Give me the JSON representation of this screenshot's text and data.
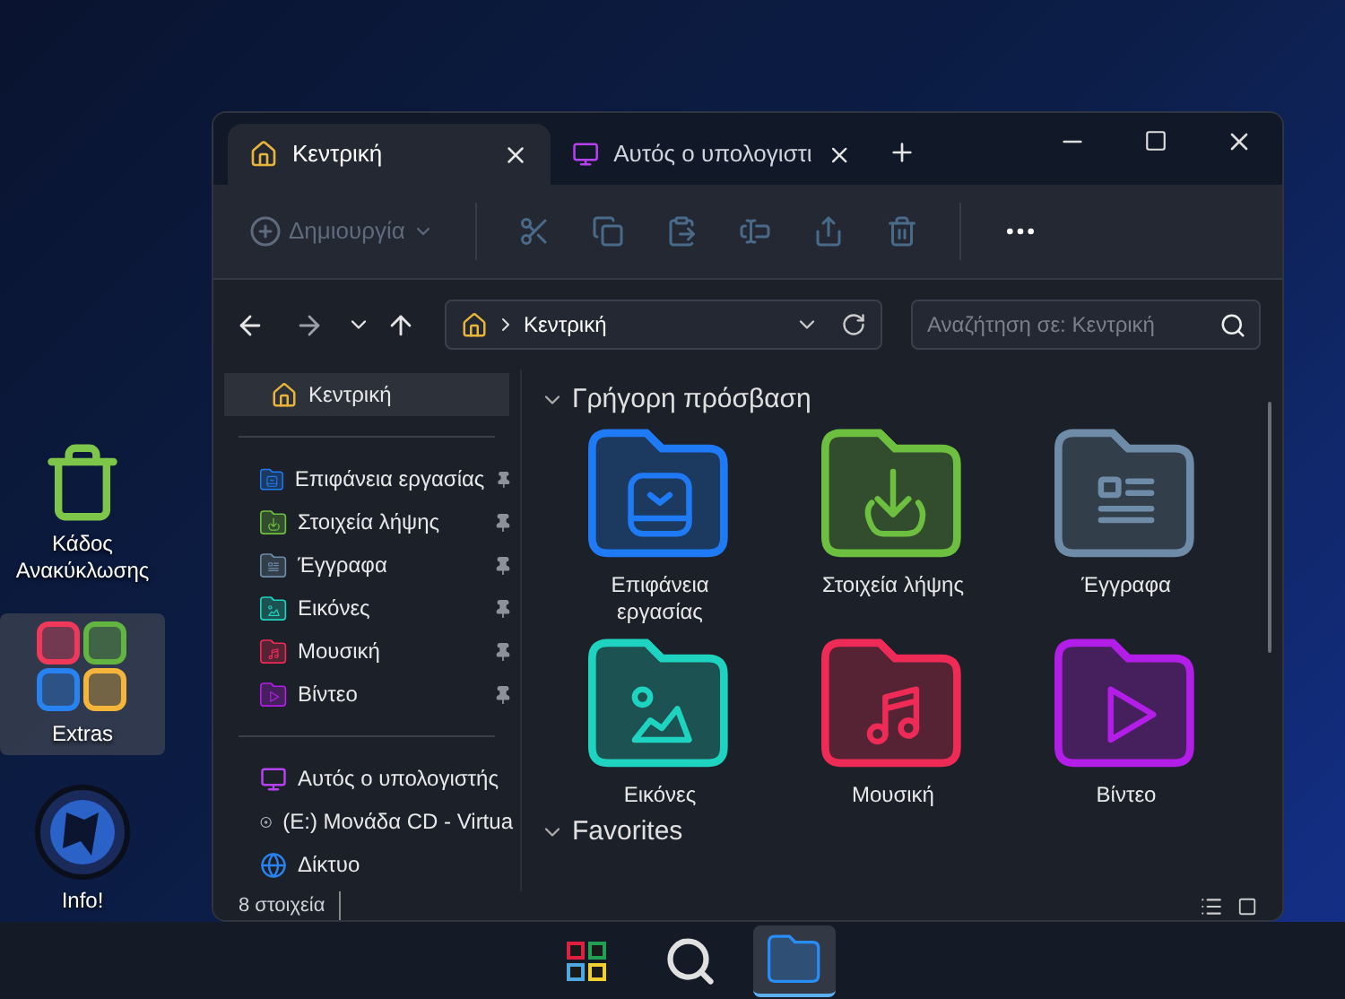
{
  "desktop_icons": [
    {
      "kind": "recycle",
      "label": "Κάδος Ανακύκλωσης",
      "selected": false
    },
    {
      "kind": "extras",
      "label": "Extras",
      "selected": true
    },
    {
      "kind": "info",
      "label": "Info!",
      "selected": false
    }
  ],
  "window": {
    "tabs": [
      {
        "kind": "home",
        "label": "Κεντρική",
        "selected": true
      },
      {
        "kind": "pc",
        "label": "Αυτός ο υπολογιστι",
        "selected": false
      }
    ],
    "toolbar": {
      "new_label": "Δημιουργία"
    },
    "address": "Κεντρική",
    "search": {
      "placeholder": "Αναζήτηση σε: Κεντρική"
    },
    "sidebar": [
      {
        "items": [
          {
            "kind": "home",
            "label": "Κεντρική",
            "selected": true
          }
        ]
      },
      {
        "items": [
          {
            "kind": "desktop",
            "color": "#1e7bf5",
            "label": "Επιφάνεια εργασίας",
            "selected": false,
            "pinned": true
          },
          {
            "kind": "download",
            "color": "#6cbf3f",
            "label": "Στοιχεία λήψης",
            "selected": false,
            "pinned": true
          },
          {
            "kind": "document",
            "color": "#6e8ca8",
            "label": "Έγγραφα",
            "selected": false,
            "pinned": true
          },
          {
            "kind": "picture",
            "color": "#1ed3c0",
            "label": "Εικόνες",
            "selected": false,
            "pinned": true
          },
          {
            "kind": "music",
            "color": "#ee2a56",
            "label": "Μουσική",
            "selected": false,
            "pinned": true
          },
          {
            "kind": "video",
            "color": "#b21ee8",
            "label": "Βίντεο",
            "selected": false,
            "pinned": true
          }
        ]
      },
      {
        "items": [
          {
            "kind": "pc",
            "label": "Αυτός ο υπολογιστής",
            "selected": false
          },
          {
            "kind": "cd",
            "label": "(E:) Μονάδα CD - Virtua",
            "selected": false
          },
          {
            "kind": "network",
            "label": "Δίκτυο",
            "selected": false
          }
        ]
      }
    ],
    "sections": [
      {
        "title": "Γρήγορη πρόσβαση",
        "expanded": true,
        "items": [
          {
            "kind": "desktop",
            "color": "#1e7bf5",
            "label": "Επιφάνεια εργασίας"
          },
          {
            "kind": "download",
            "color": "#6cbf3f",
            "label": "Στοιχεία λήψης"
          },
          {
            "kind": "document",
            "color": "#6e8ca8",
            "label": "Έγγραφα"
          },
          {
            "kind": "picture",
            "color": "#1ed3c0",
            "label": "Εικόνες"
          },
          {
            "kind": "music",
            "color": "#ee2a56",
            "label": "Μουσική"
          },
          {
            "kind": "video",
            "color": "#b21ee8",
            "label": "Βίντεο"
          }
        ]
      },
      {
        "title": "Favorites",
        "expanded": true
      }
    ],
    "status_bar": "8 στοιχεία"
  },
  "taskbar": [
    {
      "kind": "start",
      "selected": false
    },
    {
      "kind": "search",
      "selected": false
    },
    {
      "kind": "explorer",
      "selected": true
    }
  ]
}
